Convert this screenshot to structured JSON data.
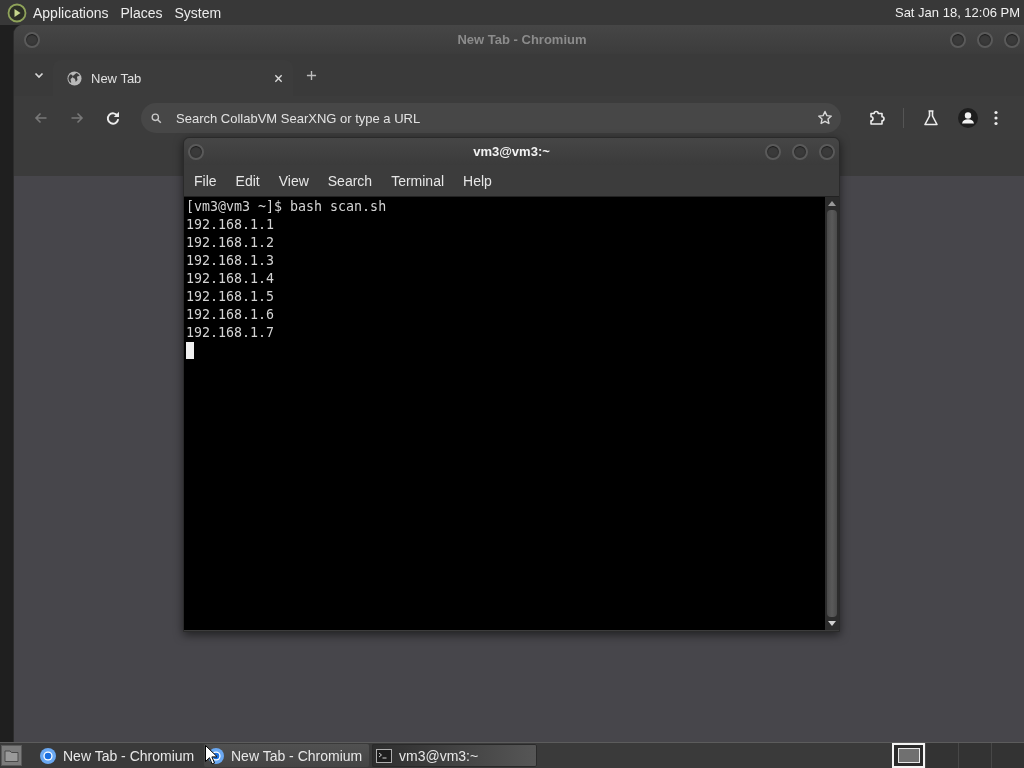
{
  "top_panel": {
    "menus": [
      "Applications",
      "Places",
      "System"
    ],
    "clock": "Sat Jan 18, 12:06 PM"
  },
  "browser": {
    "title": "New Tab - Chromium",
    "focused": false,
    "tabs": [
      {
        "label": "New Tab",
        "selected": true
      }
    ],
    "nav_buttons": [
      {
        "kind": "back",
        "disabled": true
      },
      {
        "kind": "forward",
        "disabled": true
      },
      {
        "kind": "reload",
        "disabled": false
      }
    ],
    "omnibox": {
      "placeholder": "Search CollabVM SearXNG or type a URL"
    }
  },
  "terminal": {
    "title": "vm3@vm3:~",
    "focused": true,
    "menus": [
      "File",
      "Edit",
      "View",
      "Search",
      "Terminal",
      "Help"
    ],
    "lines": [
      "[vm3@vm3 ~]$ bash scan.sh",
      "192.168.1.1",
      "192.168.1.2",
      "192.168.1.3",
      "192.168.1.4",
      "192.168.1.5",
      "192.168.1.6",
      "192.168.1.7"
    ]
  },
  "taskbar": {
    "tasks": [
      {
        "label": "New Tab - Chromium",
        "kind": "browser",
        "selected": false,
        "hovered": false
      },
      {
        "label": "New Tab - Chromium",
        "kind": "browser",
        "selected": false,
        "hovered": true
      },
      {
        "label": "vm3@vm3:~",
        "kind": "terminal",
        "selected": true,
        "hovered": false
      }
    ],
    "workspaces": [
      {
        "selected": true
      },
      {
        "selected": false
      },
      {
        "selected": false
      },
      {
        "selected": false
      }
    ]
  }
}
